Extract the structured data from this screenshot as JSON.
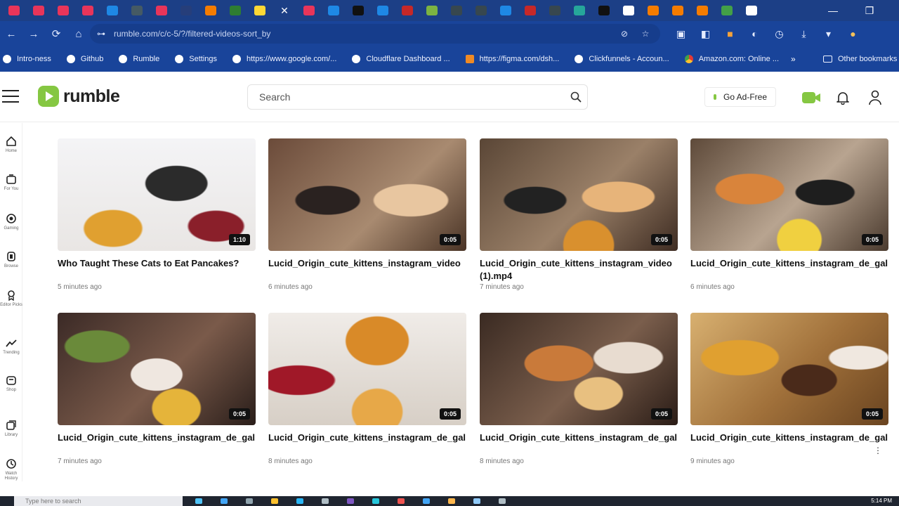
{
  "browser": {
    "tab_colors": [
      "#e8355a",
      "#e8355a",
      "#e8355a",
      "#e8355a",
      "#1e88e5",
      "#455a64",
      "#e8355a",
      "#263e7a",
      "#f57c00",
      "#2e7d32",
      "#fdd835",
      "#ffffff",
      "#e8355a",
      "#1e88e5",
      "#111111",
      "#1e88e5",
      "#c62828",
      "#7cb342",
      "#37474f",
      "#37474f",
      "#1e88e5",
      "#c62828",
      "#37474f",
      "#26a69a",
      "#111111",
      "#ffffff",
      "#f57c00",
      "#f57c00",
      "#f57c00",
      "#43a047",
      "#ffffff"
    ],
    "active_tab_icon": "close-icon",
    "url": "rumble.com/c/c-5/?/filtered-videos-sort_by",
    "bookmarks": [
      {
        "label": "Intro-ness",
        "icon": "globe"
      },
      {
        "label": "Github",
        "icon": "globe"
      },
      {
        "label": "Rumble",
        "icon": "globe"
      },
      {
        "label": "Settings",
        "icon": "globe"
      },
      {
        "label": "https://www.google.com/...",
        "icon": "globe"
      },
      {
        "label": "Cloudflare Dashboard ...",
        "icon": "globe"
      },
      {
        "label": "https://figma.com/dsh...",
        "icon": "square"
      },
      {
        "label": "Clickfunnels - Accoun...",
        "icon": "globe"
      },
      {
        "label": "Amazon.com: Online ...",
        "icon": "chrome"
      }
    ],
    "bookmarks_more": "»",
    "bookmarks_folder": "Other bookmarks"
  },
  "header": {
    "logo_text": "rumble",
    "search_placeholder": "Search",
    "go_adfree": "Go Ad-Free",
    "accent": "#85c742"
  },
  "rail": [
    {
      "label": "Home",
      "icon": "home-icon"
    },
    {
      "label": "For You",
      "icon": "for-you-icon"
    },
    {
      "label": "Gaming",
      "icon": "gaming-icon"
    },
    {
      "label": "Browse",
      "icon": "browse-icon"
    },
    {
      "label": "Editor Picks",
      "icon": "editor-picks-icon"
    },
    {
      "label": "Trending",
      "icon": "trending-icon"
    },
    {
      "label": "Shop",
      "icon": "shop-icon"
    },
    {
      "label": "Library",
      "icon": "library-icon"
    },
    {
      "label": "Watch History",
      "icon": "history-icon"
    }
  ],
  "videos": [
    {
      "title": "Who Taught These Cats to Eat Pancakes?",
      "meta": "5 minutes ago",
      "duration": "1:10"
    },
    {
      "title": "Lucid_Origin_cute_kittens_instagram_video",
      "meta": "6 minutes ago",
      "duration": "0:05"
    },
    {
      "title": "Lucid_Origin_cute_kittens_instagram_video (1).mp4",
      "meta": "7 minutes ago",
      "duration": "0:05"
    },
    {
      "title": "Lucid_Origin_cute_kittens_instagram_de_gal",
      "meta": "6 minutes ago",
      "duration": "0:05"
    },
    {
      "title": "Lucid_Origin_cute_kittens_instagram_de_gal",
      "meta": "7 minutes ago",
      "duration": "0:05"
    },
    {
      "title": "Lucid_Origin_cute_kittens_instagram_de_gal",
      "meta": "8 minutes ago",
      "duration": "0:05"
    },
    {
      "title": "Lucid_Origin_cute_kittens_instagram_de_gal",
      "meta": "8 minutes ago",
      "duration": "0:05"
    },
    {
      "title": "Lucid_Origin_cute_kittens_instagram_de_gal",
      "meta": "9 minutes ago",
      "duration": "0:05"
    }
  ],
  "taskbar": {
    "search_placeholder": "Type here to search",
    "clock": "5:14 PM"
  }
}
